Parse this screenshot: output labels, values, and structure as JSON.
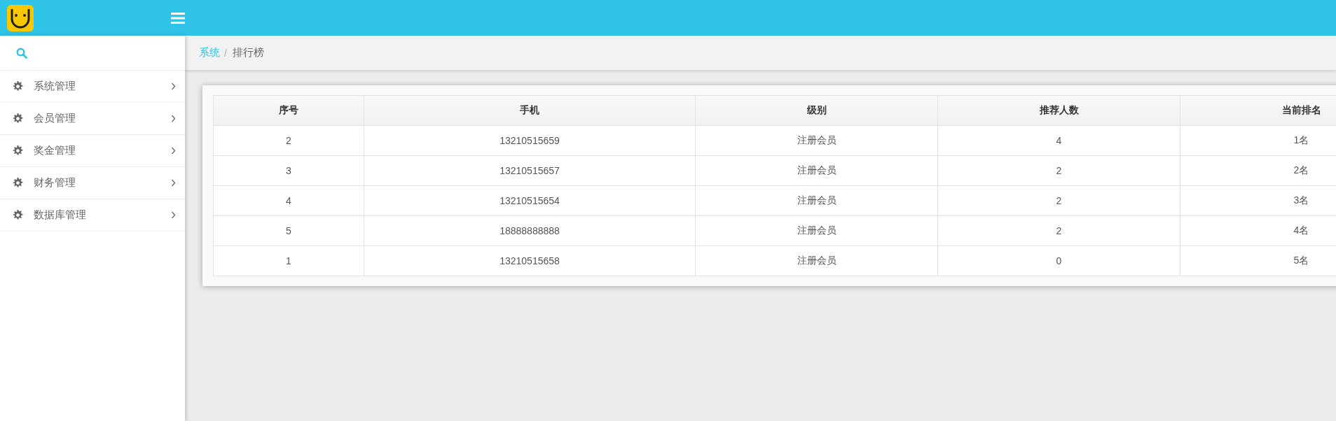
{
  "sidebar": {
    "items": [
      {
        "label": "系统管理",
        "expanded": false
      },
      {
        "label": "会员管理",
        "expanded": false
      },
      {
        "label": "奖金管理",
        "expanded": false
      },
      {
        "label": "财务管理",
        "expanded": false
      },
      {
        "label": "数据库管理",
        "expanded": false
      }
    ]
  },
  "breadcrumb": [
    {
      "label": "系统",
      "kind": "link"
    },
    {
      "label": "/",
      "kind": "separator"
    },
    {
      "label": "排行榜",
      "kind": "current"
    }
  ],
  "table": {
    "columns": [
      "序号",
      "手机",
      "级别",
      "推荐人数",
      "当前排名"
    ],
    "rows": [
      [
        "2",
        "13210515659",
        "注册会员",
        "4",
        "1名"
      ],
      [
        "3",
        "13210515657",
        "注册会员",
        "2",
        "2名"
      ],
      [
        "4",
        "13210515654",
        "注册会员",
        "2",
        "3名"
      ],
      [
        "5",
        "18888888888",
        "注册会员",
        "2",
        "4名"
      ],
      [
        "1",
        "13210515658",
        "注册会员",
        "0",
        "5名"
      ]
    ]
  }
}
